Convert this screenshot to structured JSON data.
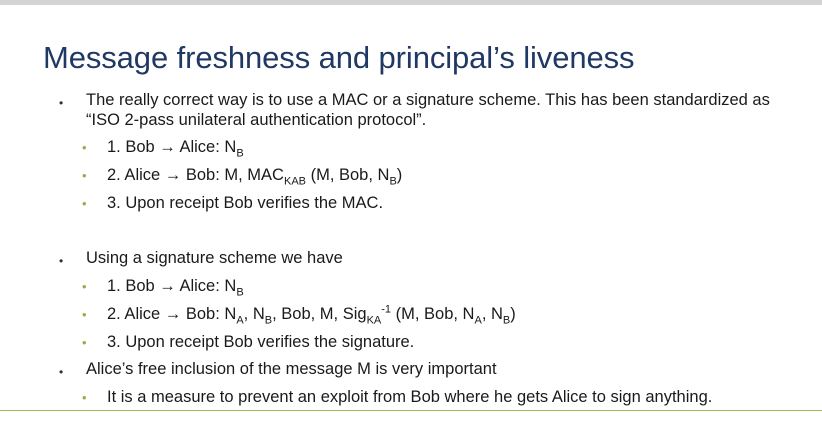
{
  "title": "Message freshness and principal’s liveness",
  "colors": {
    "title": "#1f3864",
    "sub_bullet": "#8fb04a",
    "bottom_line": "#9bbb59"
  },
  "slide": {
    "p1_line1": "The really correct way is to use a MAC or a signature scheme. This has been standardized as",
    "p1_line2": "“ISO 2-pass unilateral authentication protocol”.",
    "p1_s1_text": "1. Bob → Alice: N",
    "p1_s1_sub": "B",
    "p1_s2_text": "2. Alice → Bob: M, MAC",
    "p1_s2_sub": "KAB",
    "p1_s2_rest": " (M, Bob, N",
    "p1_s2_sub2": "B",
    "p1_s2_close": ")",
    "p1_s3": "3. Upon receipt Bob verifies the MAC.",
    "p2": "Using a signature scheme we have",
    "p2_s1_text": "1. Bob → Alice: N",
    "p2_s1_sub": "B",
    "p2_s2_a": "2. Alice → Bob: N",
    "p2_s2_a_sub": "A",
    "p2_s2_b": ", N",
    "p2_s2_b_sub": "B",
    "p2_s2_c": ", Bob, M, Sig",
    "p2_s2_c_sub": "KA",
    "p2_s2_c_sup": "-1",
    "p2_s2_d": " (M, Bob, N",
    "p2_s2_d_sub": "A",
    "p2_s2_e": ", N",
    "p2_s2_e_sub": "B",
    "p2_s2_close": ")",
    "p2_s3": "3. Upon receipt Bob verifies the signature.",
    "p3": "Alice’s free inclusion of the message M is very important",
    "p3_s1": "It is a measure to prevent an exploit from Bob where he gets Alice to sign anything."
  }
}
